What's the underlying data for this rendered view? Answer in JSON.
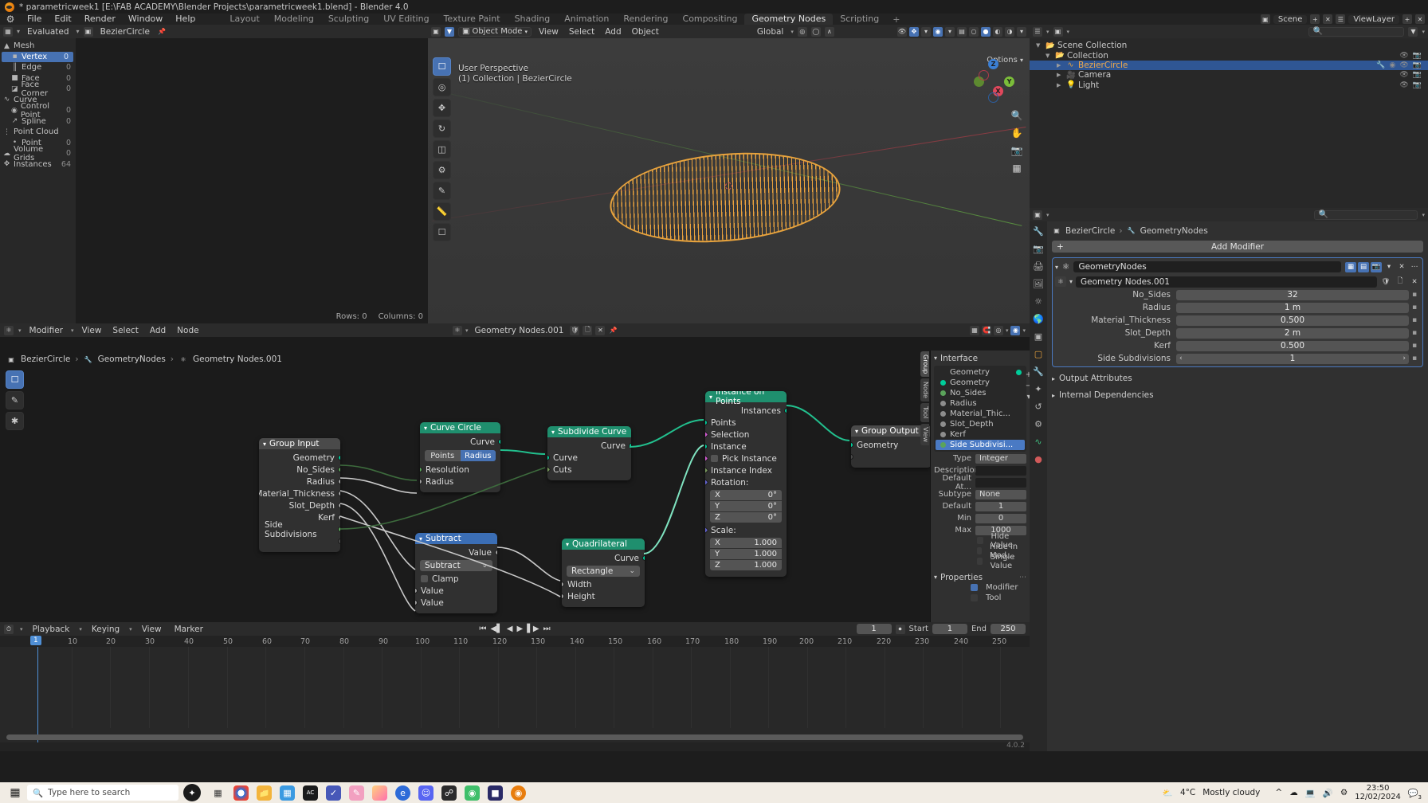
{
  "window": {
    "title": "* parametricweek1 [E:\\FAB ACADEMY\\Blender Projects\\parametricweek1.blend] - Blender 4.0"
  },
  "topbar": {
    "menus": [
      "File",
      "Edit",
      "Render",
      "Window",
      "Help"
    ],
    "workspaces": [
      "Layout",
      "Modeling",
      "Sculpting",
      "UV Editing",
      "Texture Paint",
      "Shading",
      "Animation",
      "Rendering",
      "Compositing",
      "Geometry Nodes",
      "Scripting"
    ],
    "active_workspace": "Geometry Nodes",
    "add_workspace": "+",
    "scene_name": "Scene",
    "viewlayer_name": "ViewLayer"
  },
  "spreadsheet": {
    "header": {
      "dataset_label": "Evaluated",
      "object_name": "BezierCircle"
    },
    "domains": [
      {
        "label": "Mesh",
        "count": "",
        "icon": "mesh-icon",
        "indent": 0
      },
      {
        "label": "Vertex",
        "count": "0",
        "icon": "vertex-icon",
        "indent": 1,
        "selected": true
      },
      {
        "label": "Edge",
        "count": "0",
        "icon": "edge-icon",
        "indent": 1
      },
      {
        "label": "Face",
        "count": "0",
        "icon": "face-icon",
        "indent": 1
      },
      {
        "label": "Face Corner",
        "count": "0",
        "icon": "face-corner-icon",
        "indent": 1
      },
      {
        "label": "Curve",
        "count": "",
        "icon": "curve-icon",
        "indent": 0
      },
      {
        "label": "Control Point",
        "count": "0",
        "icon": "control-point-icon",
        "indent": 1
      },
      {
        "label": "Spline",
        "count": "0",
        "icon": "spline-icon",
        "indent": 1
      },
      {
        "label": "Point Cloud",
        "count": "",
        "icon": "point-cloud-icon",
        "indent": 0
      },
      {
        "label": "Point",
        "count": "0",
        "icon": "point-icon",
        "indent": 1
      },
      {
        "label": "Volume Grids",
        "count": "0",
        "icon": "volume-icon",
        "indent": 0
      },
      {
        "label": "Instances",
        "count": "64",
        "icon": "instances-icon",
        "indent": 0
      }
    ],
    "status": {
      "rows": "Rows: 0",
      "columns": "Columns: 0"
    }
  },
  "viewport": {
    "mode": "Object Mode",
    "menus": [
      "View",
      "Select",
      "Add",
      "Object"
    ],
    "transform_orientation": "Global",
    "options_label": "Options",
    "overlay_line1": "User Perspective",
    "overlay_line2": "(1) Collection | BezierCircle",
    "gizmo_axes": [
      "Z",
      "Y",
      "X"
    ],
    "tools": [
      "select-box-tool",
      "cursor-tool",
      "move-tool",
      "rotate-tool",
      "scale-tool",
      "transform-tool",
      "annotate-tool",
      "measure-tool",
      "add-cube-tool"
    ]
  },
  "outliner": {
    "search_placeholder": "",
    "items": [
      {
        "label": "Scene Collection",
        "indent": 0,
        "icon": "collection-icon"
      },
      {
        "label": "Collection",
        "indent": 1,
        "icon": "collection-icon"
      },
      {
        "label": "BezierCircle",
        "indent": 2,
        "icon": "curve-object-icon",
        "selected": true
      },
      {
        "label": "Camera",
        "indent": 2,
        "icon": "camera-icon"
      },
      {
        "label": "Light",
        "indent": 2,
        "icon": "light-icon"
      }
    ]
  },
  "properties": {
    "breadcrumb": [
      "BezierCircle",
      "GeometryNodes"
    ],
    "add_modifier_label": "Add Modifier",
    "modifier": {
      "name": "GeometryNodes",
      "node_group": "Geometry Nodes.001",
      "inputs": [
        {
          "label": "No_Sides",
          "value": "32"
        },
        {
          "label": "Radius",
          "value": "1 m"
        },
        {
          "label": "Material_Thickness",
          "value": "0.500"
        },
        {
          "label": "Slot_Depth",
          "value": "2 m"
        },
        {
          "label": "Kerf",
          "value": "0.500"
        },
        {
          "label": "Side Subdivisions",
          "value": "1"
        }
      ]
    },
    "sections": [
      "Output Attributes",
      "Internal Dependencies"
    ]
  },
  "node_editor": {
    "header": {
      "editor_label": "Modifier",
      "menus": [
        "View",
        "Select",
        "Add",
        "Node"
      ],
      "node_group_name": "Geometry Nodes.001"
    },
    "breadcrumb": [
      "BezierCircle",
      "GeometryNodes",
      "Geometry Nodes.001"
    ],
    "nodes": [
      {
        "name": "group-input-node",
        "title": "Group Input",
        "color": "grey",
        "outputs": [
          "Geometry",
          "No_Sides",
          "Radius",
          "Material_Thickness",
          "Slot_Depth",
          "Kerf",
          "Side Subdivisions",
          ""
        ]
      },
      {
        "name": "curve-circle-node",
        "title": "Curve Circle",
        "color": "green",
        "outputs": [
          "Curve"
        ],
        "mode_options": [
          "Points",
          "Radius"
        ],
        "mode_active": "Radius",
        "inputs": [
          "Resolution",
          "Radius"
        ]
      },
      {
        "name": "subdivide-curve-node",
        "title": "Subdivide Curve",
        "color": "green",
        "outputs": [
          "Curve"
        ],
        "inputs": [
          "Curve",
          "Cuts"
        ]
      },
      {
        "name": "subtract-node",
        "title": "Subtract",
        "color": "blue",
        "outputs": [
          "Value"
        ],
        "operation": "Subtract",
        "clamp_label": "Clamp",
        "inputs": [
          "Value",
          "Value"
        ]
      },
      {
        "name": "quadrilateral-node",
        "title": "Quadrilateral",
        "color": "green",
        "outputs": [
          "Curve"
        ],
        "shape": "Rectangle",
        "inputs": [
          "Width",
          "Height"
        ]
      },
      {
        "name": "instance-on-points-node",
        "title": "Instance on Points",
        "color": "green",
        "outputs": [
          "Instances"
        ],
        "inputs": [
          "Points",
          "Selection",
          "Instance",
          "Pick Instance",
          "Instance Index",
          "Rotation:"
        ],
        "rotation": {
          "x": "0°",
          "y": "0°",
          "z": "0°"
        },
        "scale_label": "Scale:",
        "scale": {
          "x": "1.000",
          "y": "1.000",
          "z": "1.000"
        }
      },
      {
        "name": "group-output-node",
        "title": "Group Output",
        "color": "grey",
        "inputs": [
          "Geometry",
          ""
        ]
      }
    ],
    "sidebar": {
      "interface_title": "Interface",
      "items": [
        {
          "label": "Geometry",
          "kind": "output",
          "dot": "geo"
        },
        {
          "label": "Geometry",
          "kind": "input",
          "dot": "geo"
        },
        {
          "label": "No_Sides",
          "kind": "input",
          "dot": "int"
        },
        {
          "label": "Radius",
          "kind": "input",
          "dot": "val"
        },
        {
          "label": "Material_Thic...",
          "kind": "input",
          "dot": "val"
        },
        {
          "label": "Slot_Depth",
          "kind": "input",
          "dot": "val"
        },
        {
          "label": "Kerf",
          "kind": "input",
          "dot": "val"
        },
        {
          "label": "Side Subdivisi...",
          "kind": "input",
          "dot": "int",
          "selected": true
        }
      ],
      "fields": [
        {
          "label": "Type",
          "value": "Integer",
          "style": "dark"
        },
        {
          "label": "Description",
          "value": "",
          "style": "dark"
        },
        {
          "label": "Default At...",
          "value": "",
          "style": "dark"
        },
        {
          "label": "Subtype",
          "value": "None",
          "style": "dark"
        },
        {
          "label": "Default",
          "value": "1",
          "style": "grey"
        },
        {
          "label": "Min",
          "value": "0",
          "style": "grey"
        },
        {
          "label": "Max",
          "value": "1000",
          "style": "grey"
        }
      ],
      "checkboxes": [
        {
          "label": "Hide Value",
          "checked": false
        },
        {
          "label": "Hide in Mod...",
          "checked": false
        },
        {
          "label": "Single Value",
          "checked": false
        }
      ],
      "properties_title": "Properties",
      "properties_checkboxes": [
        {
          "label": "Modifier",
          "checked": true
        },
        {
          "label": "Tool",
          "checked": false
        }
      ],
      "nav_tabs": [
        "Group",
        "Node",
        "Tool",
        "View"
      ]
    }
  },
  "timeline": {
    "menus": [
      "Playback",
      "Keying",
      "View",
      "Marker"
    ],
    "current_frame": "1",
    "start_label": "Start",
    "start_value": "1",
    "end_label": "End",
    "end_value": "250",
    "ticks": [
      "10",
      "20",
      "30",
      "40",
      "50",
      "60",
      "70",
      "80",
      "90",
      "100",
      "110",
      "120",
      "130",
      "140",
      "150",
      "160",
      "170",
      "180",
      "190",
      "200",
      "210",
      "220",
      "230",
      "240",
      "250"
    ],
    "playhead_label": "1"
  },
  "status": {
    "version": "4.0.2"
  },
  "taskbar": {
    "search_placeholder": "Type here to search",
    "weather_temp": "4°C",
    "weather_desc": "Mostly cloudy",
    "time": "23:50",
    "date": "12/02/2024",
    "notification_count": "3",
    "apps": [
      "task-view-icon",
      "chrome-icon",
      "explorer-icon",
      "store-icon",
      "app-icon",
      "teams-icon",
      "sketch-icon",
      "paint-icon",
      "edge-icon",
      "discord-icon",
      "ghost-icon",
      "frog-icon",
      "affinity-icon",
      "blender-icon"
    ]
  },
  "colors": {
    "accent_blue": "#4772b3",
    "node_green": "#1f8f6e",
    "node_blue": "#3b6eb5",
    "geometry_socket": "#00cc9a",
    "object_orange": "#e8a33d"
  }
}
